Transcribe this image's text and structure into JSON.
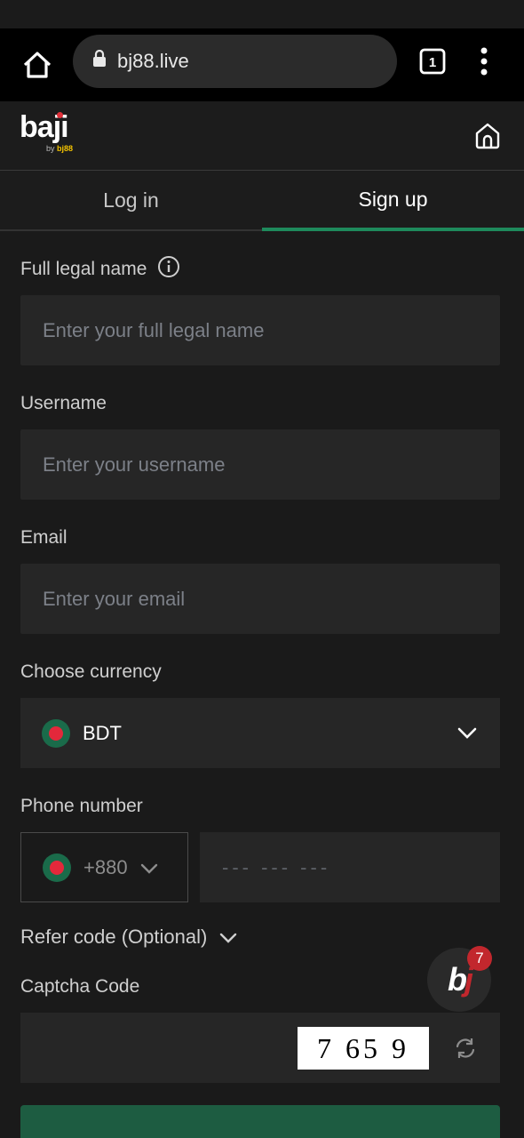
{
  "browser": {
    "url": "bj88.live",
    "tab_count": "1"
  },
  "site": {
    "logo_text": "baji",
    "logo_sub_prefix": "by",
    "logo_sub_brand": "bj88"
  },
  "auth_tabs": {
    "login": "Log in",
    "signup": "Sign up",
    "active": "signup"
  },
  "form": {
    "full_name": {
      "label": "Full legal name",
      "placeholder": "Enter your full legal name"
    },
    "username": {
      "label": "Username",
      "placeholder": "Enter your username"
    },
    "email": {
      "label": "Email",
      "placeholder": "Enter your email"
    },
    "currency": {
      "label": "Choose currency",
      "value": "BDT"
    },
    "phone": {
      "label": "Phone number",
      "country_code": "+880",
      "placeholder": "--- --- ---"
    },
    "refer": {
      "label": "Refer code (Optional)"
    },
    "captcha": {
      "label": "Captcha Code",
      "code": "7 65 9"
    }
  },
  "chat_widget": {
    "badge": "7"
  },
  "colors": {
    "accent": "#1e8a5c",
    "background": "#1a1a1a",
    "input_bg": "#262626",
    "badge": "#c2272d"
  }
}
